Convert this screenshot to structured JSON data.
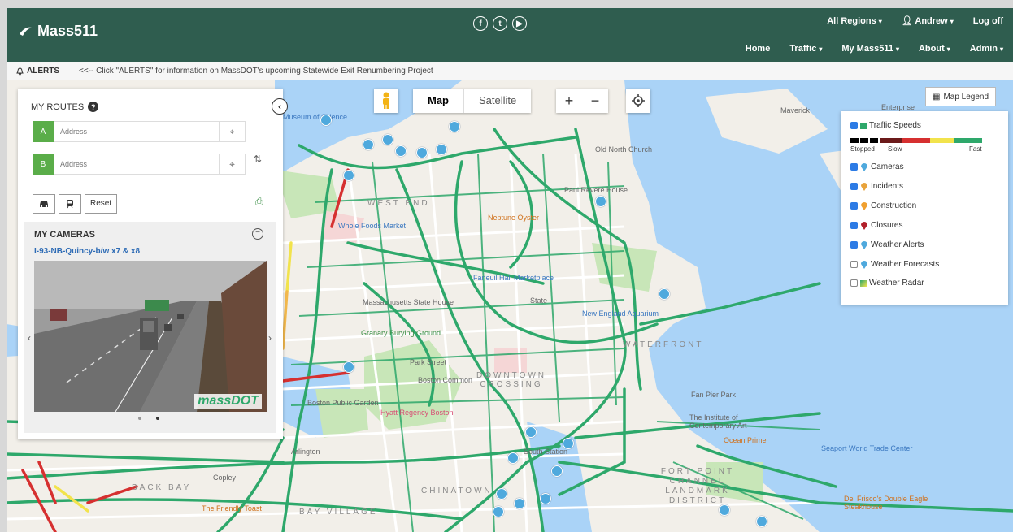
{
  "header": {
    "logo_text": "Mass511",
    "top_links": [
      "All Regions",
      "Andrew",
      "Log off"
    ],
    "nav_items": [
      "Home",
      "Traffic",
      "My Mass511",
      "About",
      "Admin"
    ],
    "social": [
      "f",
      "t",
      "▶"
    ]
  },
  "alerts": {
    "label": "ALERTS",
    "message": "<<-- Click \"ALERTS\" for information on MassDOT's upcoming Statewide Exit Renumbering Project"
  },
  "map_controls": {
    "map_label": "Map",
    "satellite_label": "Satellite",
    "zoom_in": "+",
    "zoom_out": "−"
  },
  "routes": {
    "title": "MY ROUTES",
    "from_tag": "A",
    "to_tag": "B",
    "from_placeholder": "Address",
    "to_placeholder": "Address",
    "reset_label": "Reset"
  },
  "cameras": {
    "title": "MY CAMERAS",
    "camera_name": "I-93-NB-Quincy-b/w x7 & x8",
    "watermark": "massDOT"
  },
  "legend": {
    "button_label": "Map Legend",
    "items": [
      {
        "label": "Traffic Speeds",
        "checked": true
      },
      {
        "label": "Cameras",
        "checked": true
      },
      {
        "label": "Incidents",
        "checked": true
      },
      {
        "label": "Construction",
        "checked": true
      },
      {
        "label": "Closures",
        "checked": true
      },
      {
        "label": "Weather Alerts",
        "checked": true
      },
      {
        "label": "Weather Forecasts",
        "checked": false
      },
      {
        "label": "Weather Radar",
        "checked": false
      }
    ],
    "speed_labels": [
      "Stopped",
      "Slow",
      "Fast"
    ],
    "speed_colors": [
      "#000000",
      "#6b1a1a",
      "#d63030",
      "#f2e34c",
      "#2ea86b"
    ]
  },
  "map_labels": {
    "west_end": "WEST END",
    "downtown": "DOWNTOWN CROSSING",
    "back_bay": "BACK BAY",
    "chinatown": "CHINATOWN",
    "bay_village": "BAY VILLAGE",
    "waterfront": "WATERFRONT",
    "fort_point": "FORT POINT CHANNEL LANDMARK DISTRICT",
    "whole_foods": "Whole Foods Market",
    "neptune": "Neptune Oyster",
    "old_north": "Old North Church",
    "paul_revere": "Paul Revere House",
    "faneuil": "Faneuil Hall Marketplace",
    "state_house": "Massachusetts State House",
    "granary": "Granary Burying Ground",
    "park_street": "Park Street",
    "boston_common": "Boston Common",
    "public_garden": "Boston Public Garden",
    "hyatt": "Hyatt Regency Boston",
    "new_england_aquarium": "New England Aquarium",
    "ica": "The Institute of Contemporary Art",
    "ocean_prime": "Ocean Prime",
    "seaport_hotel": "Seaport World Trade Center",
    "del_friscos": "Del Frisco's Double Eagle Steakhouse",
    "science": "Museum of Science",
    "friendly_toast": "The Friendly Toast",
    "fan_pier": "Fan Pier Park",
    "maverick": "Maverick",
    "enterprise": "Enterprise",
    "state": "State",
    "copley": "Copley",
    "arlington": "Arlington",
    "south_station": "South Station"
  }
}
